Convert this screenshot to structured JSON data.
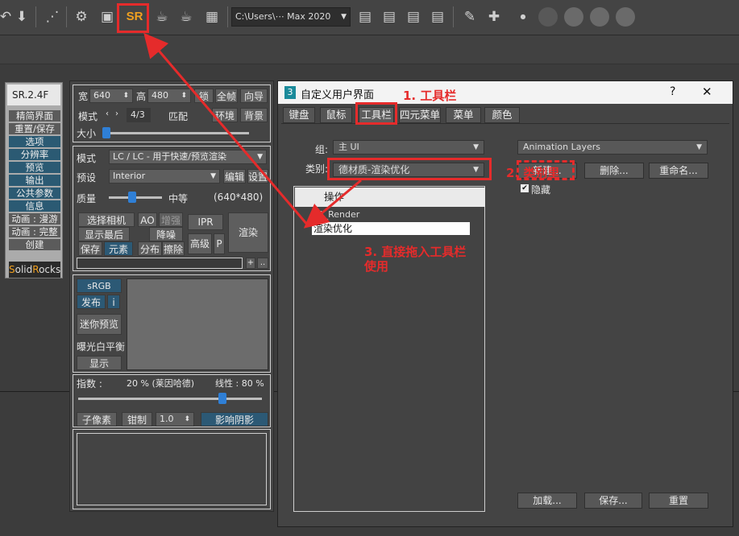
{
  "toolbar": {
    "sr_label": "SR",
    "path_dropdown": "C:\\Users\\⋯ Max 2020",
    "icons": [
      "undo-icon",
      "save-icon",
      "dotted-select-icon",
      "settings-gear-icon",
      "render-setup-icon",
      "sr-icon",
      "teapot-render-icon",
      "teapot-render-alt-icon",
      "grid-icon",
      "layer-add-icon",
      "layer-folder-icon",
      "layer-tree-icon",
      "layer-link-icon",
      "brush-icon",
      "move-icon",
      "dot-icon",
      "circle-icons"
    ]
  },
  "sr_panel": {
    "title": "SR.2.4F",
    "items": [
      {
        "label": "精简界面",
        "style": "dark"
      },
      {
        "label": "重置/保存",
        "style": "dark"
      },
      {
        "label": "选项",
        "style": "blue"
      },
      {
        "label": "分辨率",
        "style": "blue"
      },
      {
        "label": "预览",
        "style": "blue"
      },
      {
        "label": "输出",
        "style": "blue"
      },
      {
        "label": "公共参数",
        "style": "blue"
      },
      {
        "label": "信息",
        "style": "blue"
      },
      {
        "label": "动画 : 漫游",
        "style": "dark"
      },
      {
        "label": "动画 : 完整",
        "style": "dark"
      },
      {
        "label": "创建",
        "style": "dark"
      }
    ],
    "logo_s": "S",
    "logo_olid": "olid",
    "logo_r": "R",
    "logo_ocks": "ocks"
  },
  "render_panel": {
    "width_label": "宽",
    "width_value": "640",
    "height_label": "高",
    "height_value": "480",
    "lock_btn": "锁",
    "fullscreen_btn": "全帧",
    "guide_btn": "向导",
    "mode_label": "模式",
    "ratio": "4/3",
    "match_label": "匹配",
    "env_btn": "环境",
    "bg_btn": "背景",
    "size_label": "大小",
    "mode2_label": "模式",
    "mode2_value": "LC / LC - 用于快速/预览渲染",
    "preset_label": "预设",
    "preset_value": "Interior",
    "edit_btn": "编辑",
    "settings_btn": "设置",
    "quality_label": "质量",
    "quality_value": "中等",
    "quality_res": "(640*480)",
    "select_camera": "选择相机",
    "ao_btn": "AO",
    "enhance_btn": "增强",
    "ipr_btn": "IPR",
    "render_btn": "渲染",
    "show_last": "显示最后",
    "denoise": "降噪",
    "advanced": "高级",
    "p_btn": "P",
    "save_btn": "保存",
    "element_btn": "元素",
    "dist_btn": "分布",
    "dust_btn": "擦除",
    "plus_btn": "+",
    "dots_btn": "..",
    "srgb_btn": "sRGB",
    "publish_btn": "发布",
    "info_btn": "i",
    "mini_preview": "迷你预览",
    "exposure": "曝光白平衡",
    "display": "显示",
    "index_label": "指数 :",
    "index_value": "20 % (莱因哈德)",
    "linear_label": "线性 : 80 %",
    "subpixel": "子像素",
    "clamp": "钳制",
    "clamp_value": "1.0",
    "affect_shadow": "影响阴影"
  },
  "dialog": {
    "title": "自定义用户界面",
    "help": "?",
    "close": "✕",
    "tabs": [
      "键盘",
      "鼠标",
      "工具栏",
      "四元菜单",
      "菜单",
      "颜色"
    ],
    "active_tab": 2,
    "group_label": "组:",
    "group_value": "主 UI",
    "category_label": "类别:",
    "category_value": "德材质-渲染优化",
    "list_header": "操作",
    "list_items": [
      "SR_Render",
      "渲染优化"
    ],
    "toolbar_dropdown": "Animation Layers",
    "new_btn": "新建...",
    "delete_btn": "删除...",
    "rename_btn": "重命名...",
    "hide_label": "隐藏",
    "hide_checked": true,
    "load_btn": "加载...",
    "save_btn": "保存...",
    "reset_btn": "重置"
  },
  "annotations": {
    "step1": "1. 工具栏",
    "step2": "2. 类别里",
    "step3_line1": "3. 直接拖入工具栏",
    "step3_line2": "使用"
  },
  "colors": {
    "annotation": "#e52b2b",
    "accent_blue": "#2f7fd6",
    "sr_orange": "#f0a020"
  }
}
